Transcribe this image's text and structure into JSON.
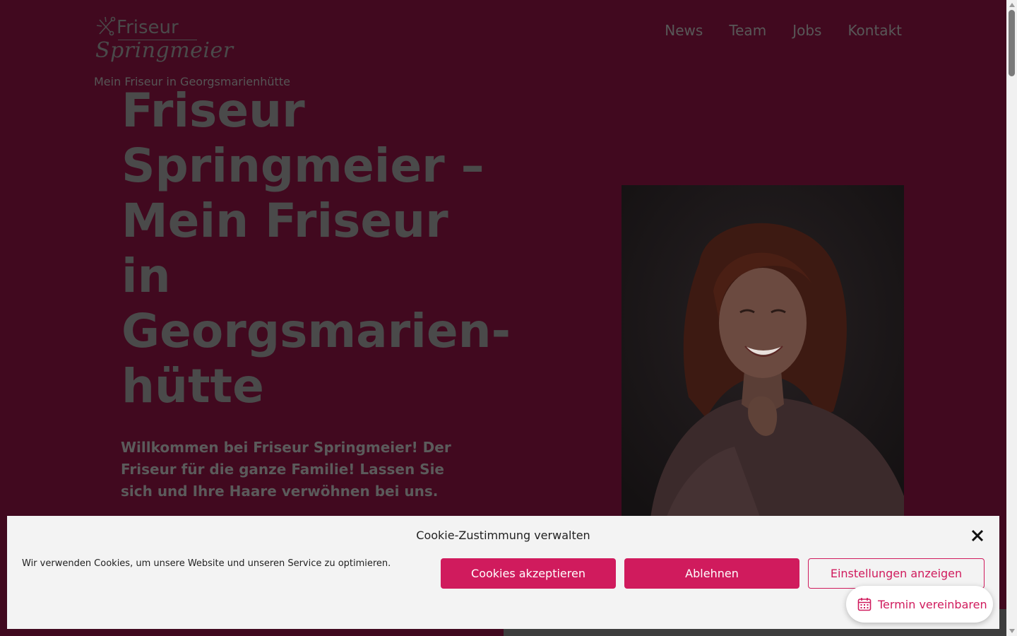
{
  "site": {
    "logo_top": "Friseur",
    "logo_script": "Springmeier",
    "tagline": "Mein Friseur in Georgsmarienhütte"
  },
  "nav": {
    "items": [
      {
        "label": "News"
      },
      {
        "label": "Team"
      },
      {
        "label": "Jobs"
      },
      {
        "label": "Kontakt"
      }
    ]
  },
  "hero": {
    "title": "Friseur Springmeier – Mein Friseur in Georgsmarien­hütte",
    "intro": "Willkommen bei Friseur Springmeier! Der Friseur für die ganze Familie! Lassen Sie sich und Ihre Haare verwöhnen bei uns."
  },
  "cookie": {
    "title": "Cookie-Zustimmung verwalten",
    "text": "Wir verwenden Cookies, um unsere Website und unseren Service zu optimieren.",
    "accept_label": "Cookies akzeptieren",
    "deny_label": "Ablehnen",
    "settings_label": "Einstellungen anzeigen"
  },
  "floating_button": {
    "label": "Termin vereinbaren",
    "icon": "calendar-icon"
  },
  "colors": {
    "page_bg": "#41091f",
    "accent": "#d01b5d",
    "banner_bg": "#f3f3f3"
  }
}
